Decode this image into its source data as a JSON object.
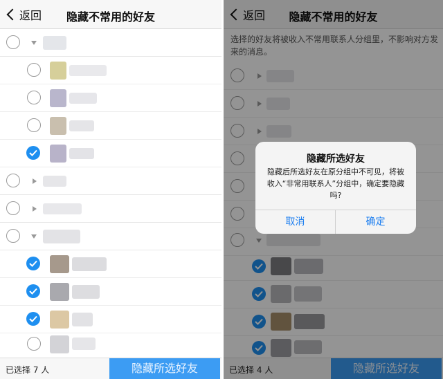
{
  "colors": {
    "accent": "#1e8ff0",
    "button": "#3c9cf3",
    "dialog_button_text": "#1e7ff0"
  },
  "left": {
    "nav": {
      "back_label": "返回",
      "title": "隐藏不常用的好友"
    },
    "bottom": {
      "selected_text": "已选择 7 人",
      "hide_button_label": "隐藏所选好友"
    }
  },
  "right": {
    "nav": {
      "back_label": "返回",
      "title": "隐藏不常用的好友"
    },
    "info_text": "选择的好友将被收入不常用联系人分组里，不影响对方发来的消息。",
    "dialog": {
      "title": "隐藏所选好友",
      "message": "隐藏后所选好友在原分组中不可见，将被收入“非常用联系人”分组中，确定要隐藏吗?",
      "cancel_label": "取消",
      "confirm_label": "确定"
    },
    "bottom": {
      "selected_text": "已选择 4 人",
      "hide_button_label": "隐藏所选好友"
    }
  },
  "icons": {
    "back": "chevron-left-icon",
    "check": "checkmark-icon",
    "expanded": "triangle-down-icon",
    "collapsed": "triangle-right-icon"
  }
}
